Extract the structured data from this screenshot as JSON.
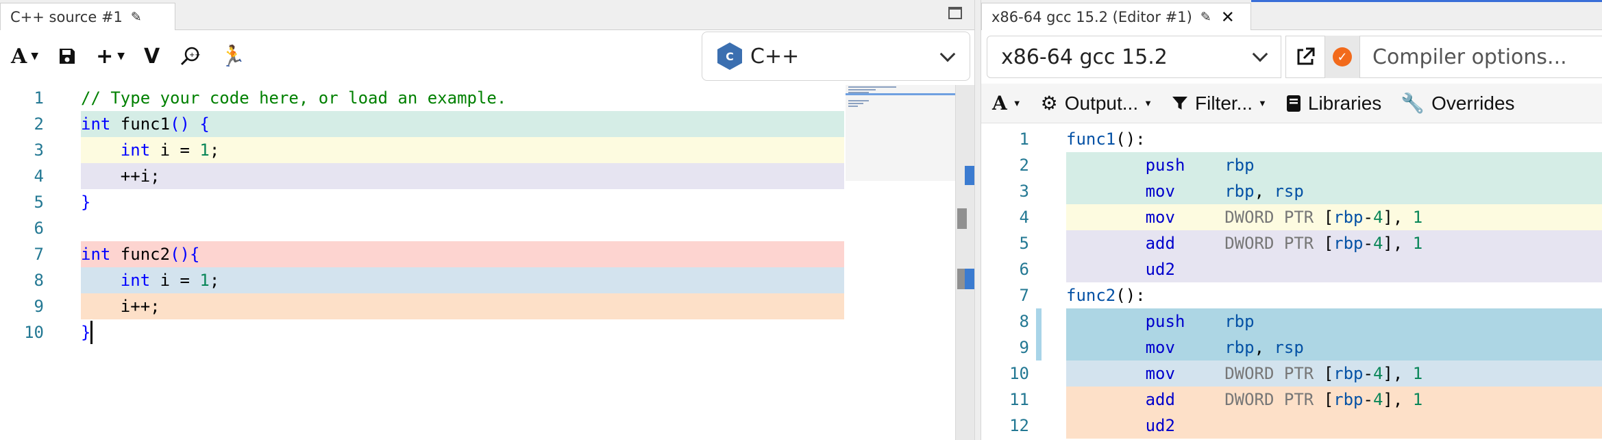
{
  "colors": {
    "teal": "#d5ede6",
    "yellow": "#fdfbe0",
    "lavender": "#e6e4f1",
    "pink": "#fdd4d0",
    "blue": "#d3e3ee",
    "peach": "#fde0c8",
    "asm_blue_dark": "#add6e4"
  },
  "left": {
    "tab_title": "C++ source #1",
    "tab_icon": "pencil-icon",
    "toolbar": {
      "font_icon": "A",
      "save_icon": "save-icon",
      "add_icon": "+",
      "vim_label": "V",
      "search_icon": "search-icon",
      "runner_icon": "runner-icon"
    },
    "language": {
      "icon_text": "C",
      "label": "C++"
    },
    "lines": [
      {
        "n": "1",
        "bg": "",
        "parts": [
          [
            "cm",
            "// Type your code here, or load an example."
          ]
        ]
      },
      {
        "n": "2",
        "bg": "teal",
        "parts": [
          [
            "kw",
            "int"
          ],
          [
            "",
            " func1"
          ],
          [
            "kw",
            "()"
          ],
          [
            "",
            " "
          ],
          [
            "kw",
            "{"
          ]
        ]
      },
      {
        "n": "3",
        "bg": "yellow",
        "parts": [
          [
            "",
            "    "
          ],
          [
            "kw",
            "int"
          ],
          [
            "",
            " i = "
          ],
          [
            "num",
            "1"
          ],
          [
            "",
            ";"
          ]
        ]
      },
      {
        "n": "4",
        "bg": "lavender",
        "parts": [
          [
            "",
            "    ++i;"
          ]
        ]
      },
      {
        "n": "5",
        "bg": "",
        "parts": [
          [
            "kw",
            "}"
          ]
        ]
      },
      {
        "n": "6",
        "bg": "",
        "parts": []
      },
      {
        "n": "7",
        "bg": "pink",
        "parts": [
          [
            "kw",
            "int"
          ],
          [
            "",
            " func2"
          ],
          [
            "kw",
            "()"
          ],
          [
            "kw",
            "{"
          ]
        ]
      },
      {
        "n": "8",
        "bg": "blue",
        "parts": [
          [
            "",
            "    "
          ],
          [
            "kw",
            "int"
          ],
          [
            "",
            " i = "
          ],
          [
            "num",
            "1"
          ],
          [
            "",
            ";"
          ]
        ]
      },
      {
        "n": "9",
        "bg": "peach",
        "parts": [
          [
            "",
            "    i++;"
          ]
        ]
      },
      {
        "n": "10",
        "bg": "",
        "parts": [
          [
            "kw",
            "}"
          ]
        ]
      }
    ]
  },
  "right": {
    "tab_title": "x86-64 gcc 15.2 (Editor #1)",
    "tab_icon": "pencil-icon",
    "close_icon": "✕",
    "compiler": "x86-64 gcc 15.2",
    "options_placeholder": "Compiler options...",
    "toolbar": {
      "font_icon": "A",
      "output_label": "Output...",
      "filter_label": "Filter...",
      "libraries_label": "Libraries",
      "overrides_label": "Overrides"
    },
    "asm_lines": [
      {
        "n": "1",
        "bg": "",
        "mark": false,
        "parts": [
          [
            "fn",
            "func1"
          ],
          [
            "",
            "():"
          ]
        ]
      },
      {
        "n": "2",
        "bg": "teal",
        "mark": false,
        "parts": [
          [
            "",
            "        "
          ],
          [
            "mn",
            "push"
          ],
          [
            "",
            "    "
          ],
          [
            "reg",
            "rbp"
          ]
        ]
      },
      {
        "n": "3",
        "bg": "teal",
        "mark": false,
        "parts": [
          [
            "",
            "        "
          ],
          [
            "mn",
            "mov"
          ],
          [
            "",
            "     "
          ],
          [
            "reg",
            "rbp"
          ],
          [
            "",
            ", "
          ],
          [
            "reg",
            "rsp"
          ]
        ]
      },
      {
        "n": "4",
        "bg": "yellow",
        "mark": false,
        "parts": [
          [
            "",
            "        "
          ],
          [
            "mn",
            "mov"
          ],
          [
            "",
            "     "
          ],
          [
            "ptr",
            "DWORD PTR "
          ],
          [
            "",
            "["
          ],
          [
            "reg",
            "rbp"
          ],
          [
            "",
            "-"
          ],
          [
            "anum",
            "4"
          ],
          [
            "",
            "], "
          ],
          [
            "anum",
            "1"
          ]
        ]
      },
      {
        "n": "5",
        "bg": "lavender",
        "mark": false,
        "parts": [
          [
            "",
            "        "
          ],
          [
            "mn",
            "add"
          ],
          [
            "",
            "     "
          ],
          [
            "ptr",
            "DWORD PTR "
          ],
          [
            "",
            "["
          ],
          [
            "reg",
            "rbp"
          ],
          [
            "",
            "-"
          ],
          [
            "anum",
            "4"
          ],
          [
            "",
            "], "
          ],
          [
            "anum",
            "1"
          ]
        ]
      },
      {
        "n": "6",
        "bg": "lavender",
        "mark": false,
        "parts": [
          [
            "",
            "        "
          ],
          [
            "mn",
            "ud2"
          ]
        ]
      },
      {
        "n": "7",
        "bg": "",
        "mark": false,
        "parts": [
          [
            "fn",
            "func2"
          ],
          [
            "",
            "():"
          ]
        ]
      },
      {
        "n": "8",
        "bg": "asm_blue_dark",
        "mark": true,
        "parts": [
          [
            "",
            "        "
          ],
          [
            "mn",
            "push"
          ],
          [
            "",
            "    "
          ],
          [
            "reg",
            "rbp"
          ]
        ]
      },
      {
        "n": "9",
        "bg": "asm_blue_dark",
        "mark": true,
        "parts": [
          [
            "",
            "        "
          ],
          [
            "mn",
            "mov"
          ],
          [
            "",
            "     "
          ],
          [
            "reg",
            "rbp"
          ],
          [
            "",
            ", "
          ],
          [
            "reg",
            "rsp"
          ]
        ]
      },
      {
        "n": "10",
        "bg": "blue",
        "mark": false,
        "parts": [
          [
            "",
            "        "
          ],
          [
            "mn",
            "mov"
          ],
          [
            "",
            "     "
          ],
          [
            "ptr",
            "DWORD PTR "
          ],
          [
            "",
            "["
          ],
          [
            "reg",
            "rbp"
          ],
          [
            "",
            "-"
          ],
          [
            "anum",
            "4"
          ],
          [
            "",
            "], "
          ],
          [
            "anum",
            "1"
          ]
        ]
      },
      {
        "n": "11",
        "bg": "peach",
        "mark": false,
        "parts": [
          [
            "",
            "        "
          ],
          [
            "mn",
            "add"
          ],
          [
            "",
            "     "
          ],
          [
            "ptr",
            "DWORD PTR "
          ],
          [
            "",
            "["
          ],
          [
            "reg",
            "rbp"
          ],
          [
            "",
            "-"
          ],
          [
            "anum",
            "4"
          ],
          [
            "",
            "], "
          ],
          [
            "anum",
            "1"
          ]
        ]
      },
      {
        "n": "12",
        "bg": "peach",
        "mark": false,
        "parts": [
          [
            "",
            "        "
          ],
          [
            "mn",
            "ud2"
          ]
        ]
      }
    ]
  }
}
